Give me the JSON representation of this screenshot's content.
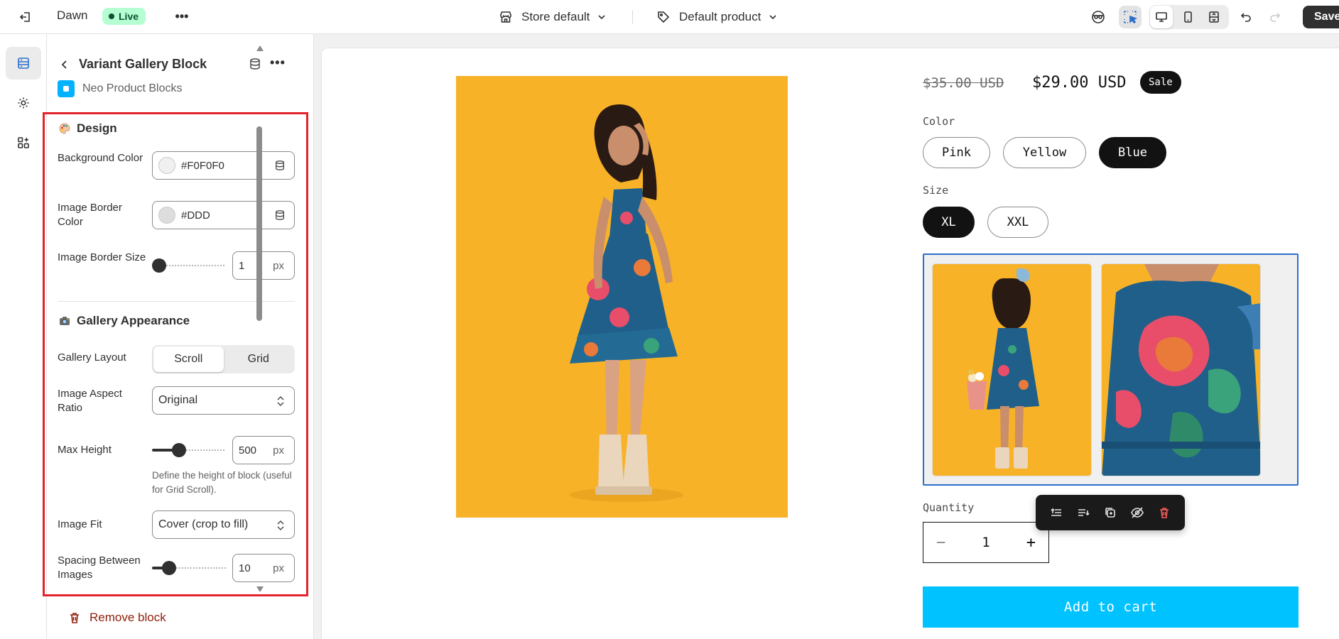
{
  "topbar": {
    "theme_name": "Dawn",
    "live_label": "Live",
    "store_selector": "Store default",
    "product_selector": "Default product",
    "save_label": "Save"
  },
  "panel": {
    "block_title": "Variant Gallery Block",
    "app_name": "Neo Product Blocks",
    "design_section": "Design",
    "background_color_label": "Background Color",
    "background_color_value": "#F0F0F0",
    "image_border_color_label": "Image Border Color",
    "image_border_color_value": "#DDD",
    "image_border_size_label": "Image Border Size",
    "image_border_size_value": "1",
    "image_border_size_level": 0.0,
    "px_unit": "px",
    "gallery_section": "Gallery Appearance",
    "gallery_layout_label": "Gallery Layout",
    "gallery_layout_options": [
      "Scroll",
      "Grid"
    ],
    "gallery_layout_selected": "Scroll",
    "aspect_ratio_label": "Image Aspect Ratio",
    "aspect_ratio_value": "Original",
    "max_height_label": "Max Height",
    "max_height_value": "500",
    "max_height_level": 0.4,
    "max_height_help": "Define the height of block (useful for Grid Scroll).",
    "image_fit_label": "Image Fit",
    "image_fit_value": "Cover (crop to fill)",
    "spacing_label": "Spacing Between Images",
    "spacing_value": "10",
    "spacing_level": 0.2,
    "remove_block": "Remove block"
  },
  "preview": {
    "price_old": "$35.00 USD",
    "price_new": "$29.00 USD",
    "sale_badge": "Sale",
    "color_label": "Color",
    "colors": [
      "Pink",
      "Yellow",
      "Blue"
    ],
    "color_selected": "Blue",
    "size_label": "Size",
    "sizes": [
      "XL",
      "XXL"
    ],
    "size_selected": "XL",
    "quantity_label": "Quantity",
    "quantity_value": "1",
    "qty_minus": "−",
    "qty_plus": "+",
    "add_to_cart": "Add to cart"
  },
  "colors": {
    "highlight": "#e3222b",
    "live_badge_bg": "#b4fed2",
    "add_to_cart_bg": "#00c2ff",
    "gallery_border": "#2c6ecb",
    "photo_background": "#f8b228",
    "dress": "#1f5f8a"
  },
  "icons": [
    "exit-icon",
    "store-icon",
    "tag-icon",
    "chevron-down-icon",
    "inspector-icon",
    "select-element-icon",
    "desktop-icon",
    "mobile-icon",
    "fullwidth-icon",
    "undo-icon",
    "redo-icon",
    "sections-icon",
    "settings-gear-icon",
    "apps-icon",
    "back-arrow-icon",
    "database-icon",
    "more-icon",
    "palette-icon",
    "camera-icon",
    "trash-icon",
    "move-up-icon",
    "move-down-icon",
    "duplicate-icon",
    "hide-icon",
    "delete-icon"
  ]
}
